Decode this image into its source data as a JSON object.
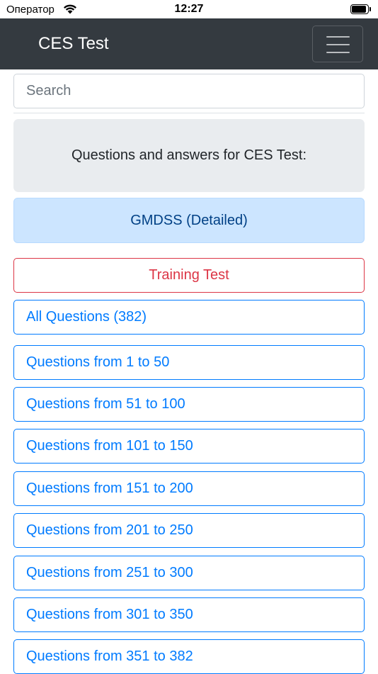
{
  "status_bar": {
    "carrier": "Оператор",
    "time": "12:27"
  },
  "navbar": {
    "brand": "CES Test",
    "background": "#343a40"
  },
  "search": {
    "placeholder": "Search",
    "value": ""
  },
  "jumbotron": {
    "text": "Questions and answers for CES Test:"
  },
  "category": {
    "label": "GMDSS (Detailed)"
  },
  "training_button": {
    "label": "Training Test",
    "color": "#dc3545"
  },
  "question_buttons": [
    {
      "label": "All Questions (382)"
    },
    {
      "label": "Questions from 1 to 50"
    },
    {
      "label": "Questions from 51 to 100"
    },
    {
      "label": "Questions from 101 to 150"
    },
    {
      "label": "Questions from 151 to 200"
    },
    {
      "label": "Questions from 201 to 250"
    },
    {
      "label": "Questions from 251 to 300"
    },
    {
      "label": "Questions from 301 to 350"
    },
    {
      "label": "Questions from 351 to 382"
    }
  ],
  "colors": {
    "primary": "#007bff",
    "danger": "#dc3545",
    "info_bg": "#cce5ff",
    "info_text": "#004085",
    "jumbotron_bg": "#e9ecef"
  },
  "icons": {
    "wifi": "wifi-icon",
    "battery": "battery-icon",
    "menu": "hamburger-menu-icon"
  }
}
